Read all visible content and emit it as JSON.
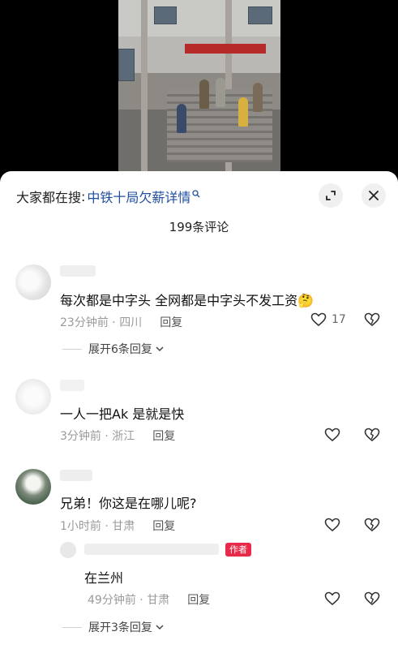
{
  "search": {
    "prefix": "大家都在搜",
    "colon": ":",
    "term": "中铁十局欠薪详情",
    "term_icon": "search-icon"
  },
  "comments_header": {
    "title": "199条评论"
  },
  "comments": [
    {
      "text": "每次都是中字头 全网都是中字头不发工资",
      "emoji": "🤔",
      "time": "23分钟前",
      "location": "四川",
      "reply_label": "回复",
      "like_count": "17",
      "expand_label": "展开6条回复"
    },
    {
      "text": "一人一把Ak 是就是快",
      "time": "3分钟前",
      "location": "浙江",
      "reply_label": "回复",
      "like_count": ""
    },
    {
      "text": "兄弟！你这是在哪儿呢?",
      "time": "1小时前",
      "location": "甘肃",
      "reply_label": "回复",
      "like_count": "",
      "sub_reply": {
        "badge": "作者",
        "text": "在兰州",
        "time": "49分钟前",
        "location": "甘肃",
        "reply_label": "回复"
      },
      "expand_label": "展开3条回复"
    }
  ],
  "colors": {
    "accent": "#1f4fa0",
    "author_badge": "#e8294a",
    "meta_text": "#9a9a9a"
  }
}
